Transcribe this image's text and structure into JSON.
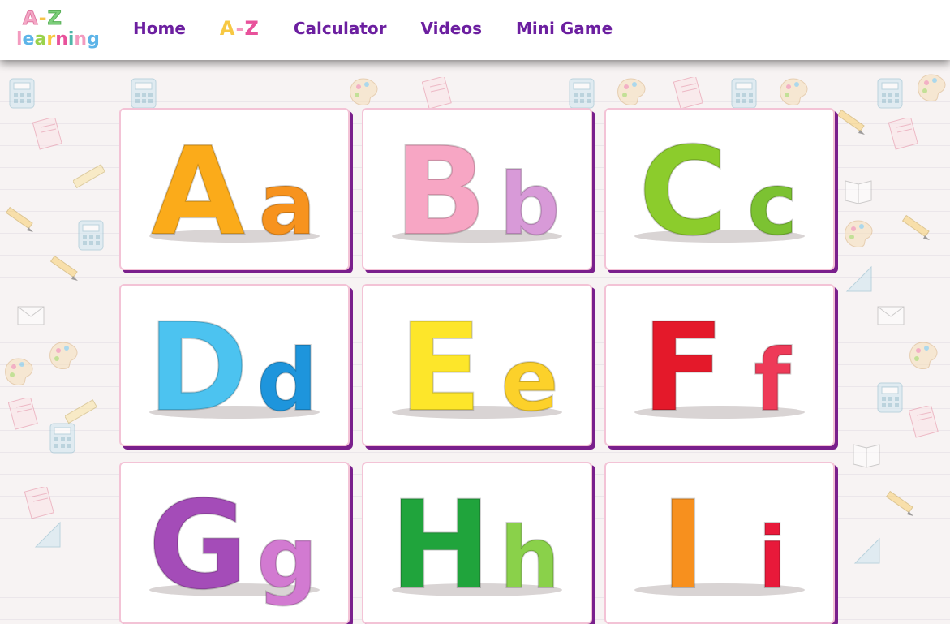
{
  "logo": {
    "line1_a": "A",
    "line1_dash": "-",
    "line1_z": "Z",
    "line2": "learning"
  },
  "nav": {
    "home": "Home",
    "az": {
      "a": "A",
      "dash": "-",
      "z": "Z"
    },
    "calculator": "Calculator",
    "videos": "Videos",
    "mini_game": "Mini Game"
  },
  "cards": [
    {
      "upper": "A",
      "lower": "a",
      "upper_color": "#fbab1a",
      "lower_color": "#f7931e"
    },
    {
      "upper": "B",
      "lower": "b",
      "upper_color": "#f7a6c4",
      "lower_color": "#d89ad8"
    },
    {
      "upper": "C",
      "lower": "c",
      "upper_color": "#8ccc2c",
      "lower_color": "#7cc232"
    },
    {
      "upper": "D",
      "lower": "d",
      "upper_color": "#4cc3f0",
      "lower_color": "#1e95dc"
    },
    {
      "upper": "E",
      "lower": "e",
      "upper_color": "#fde62a",
      "lower_color": "#fcd12a"
    },
    {
      "upper": "F",
      "lower": "f",
      "upper_color": "#e4192a",
      "lower_color": "#ee3a58"
    },
    {
      "upper": "G",
      "lower": "g",
      "upper_color": "#a44cb8",
      "lower_color": "#d27ad1"
    },
    {
      "upper": "H",
      "lower": "h",
      "upper_color": "#20a43c",
      "lower_color": "#8ad14a"
    },
    {
      "upper": "I",
      "lower": "i",
      "upper_color": "#f7901e",
      "lower_color": "#e8193a"
    }
  ],
  "colors": {
    "nav_text": "#6c1fa0",
    "card_shadow": "#7a1f8c",
    "card_border": "#f3c3d6"
  }
}
